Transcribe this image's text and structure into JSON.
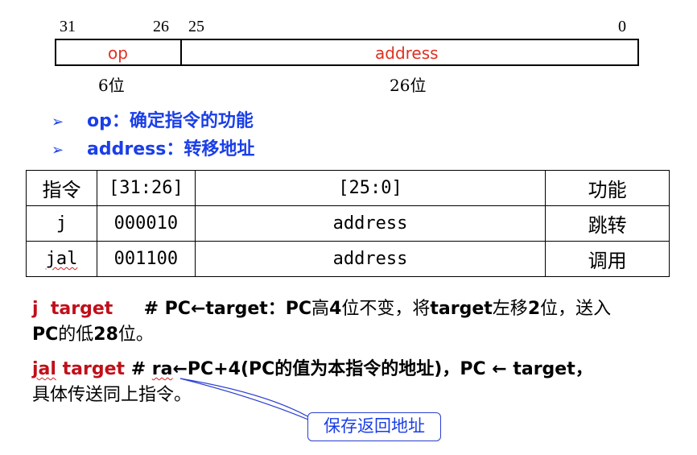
{
  "format_diagram": {
    "bit_labels": [
      "31",
      "26",
      "25",
      "0"
    ],
    "fields": [
      {
        "name": "op",
        "width": "6位"
      },
      {
        "name": "address",
        "width": "26位"
      }
    ]
  },
  "bullets": [
    {
      "term": "op",
      "desc": "：确定指令的功能"
    },
    {
      "term": "address",
      "desc": "：转移地址"
    }
  ],
  "table": {
    "headers": [
      "指令",
      "[31:26]",
      "[25:0]",
      "功能"
    ],
    "rows": [
      [
        "j",
        "000010",
        "address",
        "跳转"
      ],
      [
        "jal",
        "001100",
        "address",
        "调用"
      ]
    ]
  },
  "descriptions": {
    "j_instr": "j  target",
    "j_hash": "# PC←target：PC",
    "j_part1": "高",
    "j_part2": "4",
    "j_part3": "位不变，将",
    "j_part4": "target",
    "j_part5": "左移",
    "j_part6": "2",
    "j_part7": "位，送入",
    "j_line2a": "PC",
    "j_line2b": "的低",
    "j_line2c": "28",
    "j_line2d": "位。",
    "jal_instr_a": "jal",
    "jal_instr_b": "target",
    "jal_hash": "#",
    "jal_ra": "ra",
    "jal_rest": "←PC+4(PC的值为本指令的地址)，PC ← target，",
    "jal_line2": "具体传送同上指令。"
  },
  "callout": {
    "text": "保存返回地址"
  },
  "colors": {
    "red": "#c0101a",
    "blue": "#1a3ee8"
  }
}
